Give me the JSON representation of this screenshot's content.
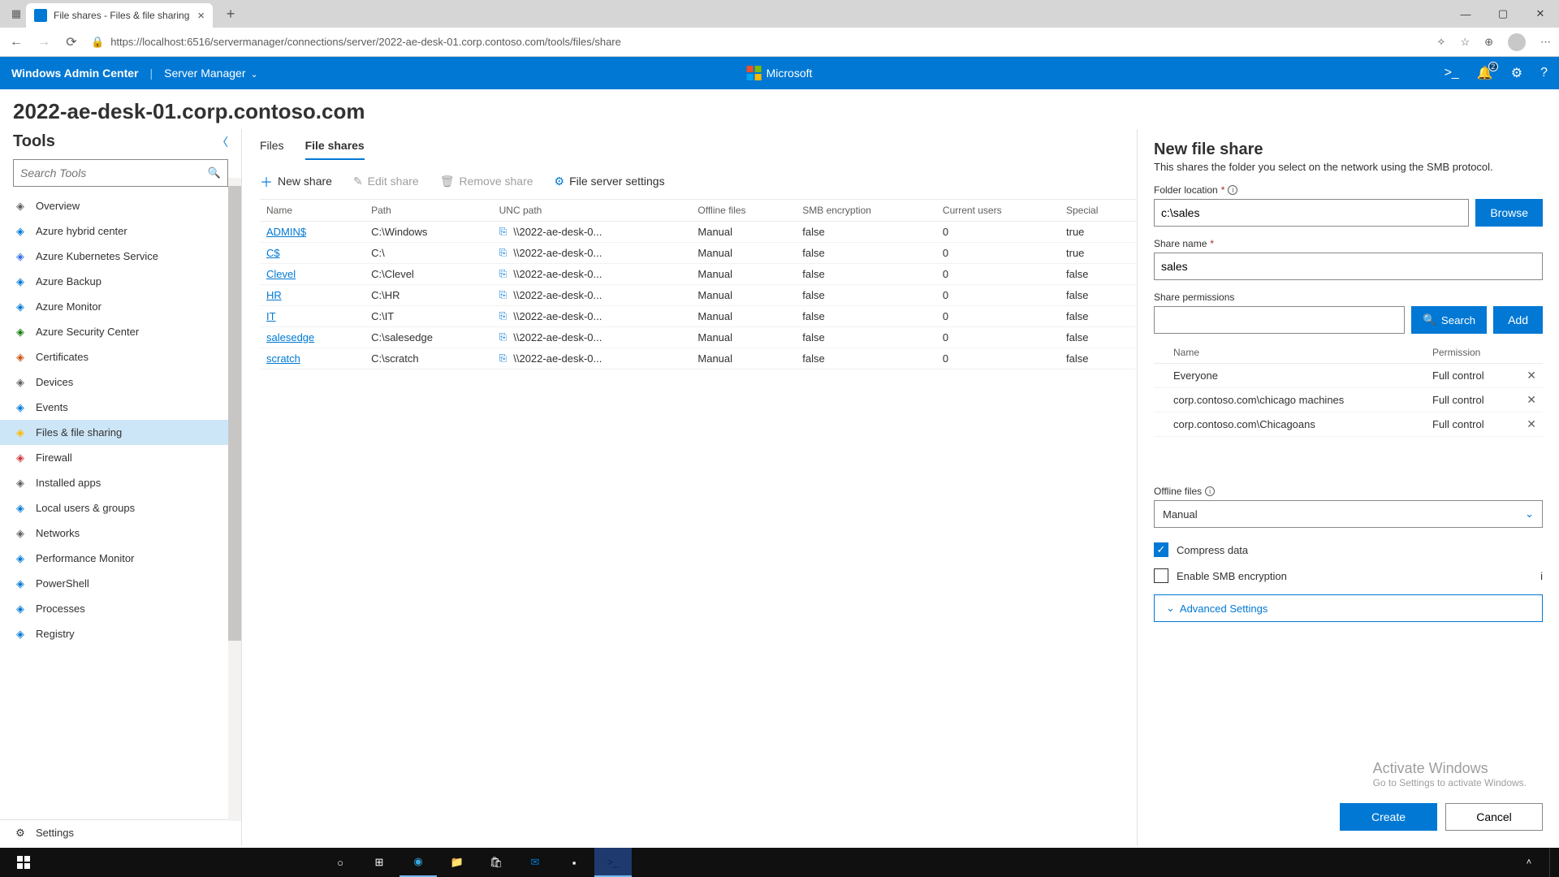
{
  "browser": {
    "tab_title": "File shares - Files & file sharing",
    "url": "https://localhost:6516/servermanager/connections/server/2022-ae-desk-01.corp.contoso.com/tools/files/share"
  },
  "header": {
    "product": "Windows Admin Center",
    "context": "Server Manager",
    "brand": "Microsoft",
    "notif_count": "2"
  },
  "server_name": "2022-ae-desk-01.corp.contoso.com",
  "tools": {
    "title": "Tools",
    "search_placeholder": "Search Tools",
    "items": [
      {
        "label": "Overview",
        "icon": "overview",
        "c": "#605e5c"
      },
      {
        "label": "Azure hybrid center",
        "icon": "azure",
        "c": "#0078d4"
      },
      {
        "label": "Azure Kubernetes Service",
        "icon": "aks",
        "c": "#326ce5"
      },
      {
        "label": "Azure Backup",
        "icon": "backup",
        "c": "#0078d4"
      },
      {
        "label": "Azure Monitor",
        "icon": "monitor",
        "c": "#0078d4"
      },
      {
        "label": "Azure Security Center",
        "icon": "sec",
        "c": "#107c10"
      },
      {
        "label": "Certificates",
        "icon": "cert",
        "c": "#ca5010"
      },
      {
        "label": "Devices",
        "icon": "dev",
        "c": "#605e5c"
      },
      {
        "label": "Events",
        "icon": "events",
        "c": "#0078d4"
      },
      {
        "label": "Files & file sharing",
        "icon": "files",
        "c": "#ffb900",
        "active": true
      },
      {
        "label": "Firewall",
        "icon": "fw",
        "c": "#d13438"
      },
      {
        "label": "Installed apps",
        "icon": "apps",
        "c": "#605e5c"
      },
      {
        "label": "Local users & groups",
        "icon": "users",
        "c": "#0078d4"
      },
      {
        "label": "Networks",
        "icon": "net",
        "c": "#605e5c"
      },
      {
        "label": "Performance Monitor",
        "icon": "perf",
        "c": "#0078d4"
      },
      {
        "label": "PowerShell",
        "icon": "ps",
        "c": "#0078d4"
      },
      {
        "label": "Processes",
        "icon": "proc",
        "c": "#0078d4"
      },
      {
        "label": "Registry",
        "icon": "reg",
        "c": "#0078d4"
      }
    ],
    "settings": "Settings"
  },
  "subtabs": {
    "files": "Files",
    "shares": "File shares"
  },
  "commands": {
    "new": "New share",
    "edit": "Edit share",
    "remove": "Remove share",
    "settings": "File server settings"
  },
  "table": {
    "cols": {
      "name": "Name",
      "path": "Path",
      "unc": "UNC path",
      "offline": "Offline files",
      "smb": "SMB encryption",
      "users": "Current users",
      "special": "Special"
    },
    "rows": [
      {
        "name": "ADMIN$",
        "path": "C:\\Windows",
        "unc": "\\\\2022-ae-desk-0...",
        "offline": "Manual",
        "smb": "false",
        "users": "0",
        "special": "true"
      },
      {
        "name": "C$",
        "path": "C:\\",
        "unc": "\\\\2022-ae-desk-0...",
        "offline": "Manual",
        "smb": "false",
        "users": "0",
        "special": "true"
      },
      {
        "name": "Clevel",
        "path": "C:\\Clevel",
        "unc": "\\\\2022-ae-desk-0...",
        "offline": "Manual",
        "smb": "false",
        "users": "0",
        "special": "false"
      },
      {
        "name": "HR",
        "path": "C:\\HR",
        "unc": "\\\\2022-ae-desk-0...",
        "offline": "Manual",
        "smb": "false",
        "users": "0",
        "special": "false"
      },
      {
        "name": "IT",
        "path": "C:\\IT",
        "unc": "\\\\2022-ae-desk-0...",
        "offline": "Manual",
        "smb": "false",
        "users": "0",
        "special": "false"
      },
      {
        "name": "salesedge",
        "path": "C:\\salesedge",
        "unc": "\\\\2022-ae-desk-0...",
        "offline": "Manual",
        "smb": "false",
        "users": "0",
        "special": "false"
      },
      {
        "name": "scratch",
        "path": "C:\\scratch",
        "unc": "\\\\2022-ae-desk-0...",
        "offline": "Manual",
        "smb": "false",
        "users": "0",
        "special": "false"
      }
    ]
  },
  "panel": {
    "title": "New file share",
    "desc": "This shares the folder you select on the network using the SMB protocol.",
    "folder_label": "Folder location",
    "folder_value": "c:\\sales",
    "browse": "Browse",
    "name_label": "Share name",
    "name_value": "sales",
    "perm_label": "Share permissions",
    "search": "Search",
    "add": "Add",
    "perm_cols": {
      "name": "Name",
      "perm": "Permission"
    },
    "perms": [
      {
        "name": "Everyone",
        "perm": "Full control"
      },
      {
        "name": "corp.contoso.com\\chicago machines",
        "perm": "Full control"
      },
      {
        "name": "corp.contoso.com\\Chicagoans",
        "perm": "Full control"
      }
    ],
    "offline_label": "Offline files",
    "offline_value": "Manual",
    "compress": "Compress data",
    "smb_enc": "Enable SMB encryption",
    "advanced": "Advanced Settings",
    "create": "Create",
    "cancel": "Cancel"
  },
  "watermark": {
    "l1": "Activate Windows",
    "l2": "Go to Settings to activate Windows."
  }
}
